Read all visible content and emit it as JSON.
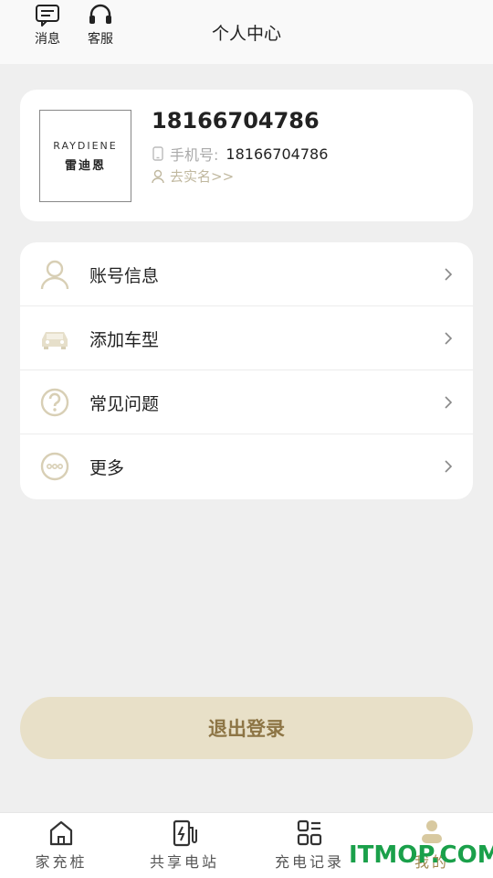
{
  "header": {
    "messages_label": "消息",
    "service_label": "客服",
    "title": "个人中心"
  },
  "profile": {
    "logo_en": "RAYDIENE",
    "logo_cn": "雷迪恩",
    "name": "18166704786",
    "phone_label": "手机号:",
    "phone_value": "18166704786",
    "realname_link": "去实名>>"
  },
  "menu": {
    "items": [
      {
        "label": "账号信息",
        "icon": "user-icon"
      },
      {
        "label": "添加车型",
        "icon": "car-icon"
      },
      {
        "label": "常见问题",
        "icon": "question-icon"
      },
      {
        "label": "更多",
        "icon": "more-icon"
      }
    ]
  },
  "logout_label": "退出登录",
  "tabs": [
    {
      "label": "家充桩",
      "icon": "home-icon"
    },
    {
      "label": "共享电站",
      "icon": "charging-station-icon"
    },
    {
      "label": "充电记录",
      "icon": "records-icon"
    },
    {
      "label": "我的",
      "icon": "profile-icon"
    }
  ],
  "watermark": "ITMOP.COM",
  "colors": {
    "accent": "#a08850",
    "logout_bg": "#e8e0c8",
    "logout_text": "#8d7545",
    "icon_tint": "#d8cfb5",
    "watermark": "#1aa04a"
  }
}
